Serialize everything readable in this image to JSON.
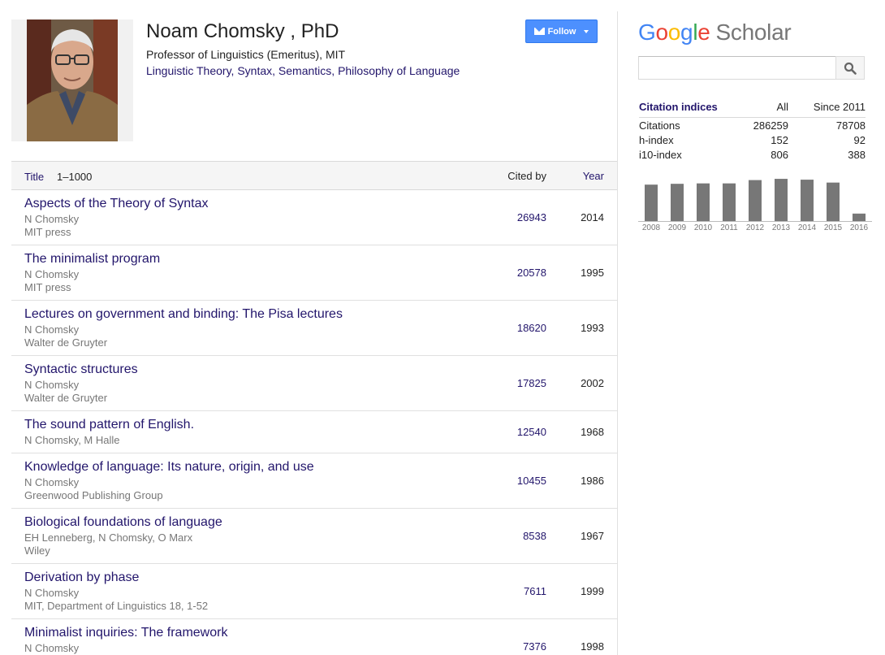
{
  "profile": {
    "name": "Noam Chomsky , PhD",
    "affiliation": "Professor of Linguistics (Emeritus), MIT",
    "interests": [
      "Linguistic Theory",
      "Syntax",
      "Semantics",
      "Philosophy of Language"
    ],
    "follow_label": "Follow"
  },
  "table": {
    "header": {
      "title": "Title",
      "range": "1–1000",
      "cited_by": "Cited by",
      "year": "Year"
    },
    "rows": [
      {
        "title": "Aspects of the Theory of Syntax",
        "authors": "N Chomsky",
        "venue": "MIT press",
        "cited": "26943",
        "year": "2014"
      },
      {
        "title": "The minimalist program",
        "authors": "N Chomsky",
        "venue": "MIT press",
        "cited": "20578",
        "year": "1995"
      },
      {
        "title": "Lectures on government and binding: The Pisa lectures",
        "authors": "N Chomsky",
        "venue": "Walter de Gruyter",
        "cited": "18620",
        "year": "1993"
      },
      {
        "title": "Syntactic structures",
        "authors": "N Chomsky",
        "venue": "Walter de Gruyter",
        "cited": "17825",
        "year": "2002"
      },
      {
        "title": "The sound pattern of English.",
        "authors": "N Chomsky, M Halle",
        "venue": "",
        "cited": "12540",
        "year": "1968"
      },
      {
        "title": "Knowledge of language: Its nature, origin, and use",
        "authors": "N Chomsky",
        "venue": "Greenwood Publishing Group",
        "cited": "10455",
        "year": "1986"
      },
      {
        "title": "Biological foundations of language",
        "authors": "EH Lenneberg, N Chomsky, O Marx",
        "venue": "Wiley",
        "cited": "8538",
        "year": "1967"
      },
      {
        "title": "Derivation by phase",
        "authors": "N Chomsky",
        "venue": "MIT, Department of Linguistics 18, 1-52",
        "cited": "7611",
        "year": "1999"
      },
      {
        "title": "Minimalist inquiries: The framework",
        "authors": "N Chomsky",
        "venue": "",
        "cited": "7376",
        "year": "1998"
      }
    ]
  },
  "sidebar": {
    "logo_google": "Google",
    "logo_scholar": "Scholar",
    "search_placeholder": "",
    "search_icon": "search-icon",
    "citation": {
      "label": "Citation indices",
      "col_all": "All",
      "col_since": "Since 2011",
      "rows": [
        {
          "key": "Citations",
          "all": "286259",
          "since": "78708"
        },
        {
          "key": "h-index",
          "all": "152",
          "since": "92"
        },
        {
          "key": "i10-index",
          "all": "806",
          "since": "388"
        }
      ]
    }
  },
  "chart_data": {
    "type": "bar",
    "categories": [
      "2008",
      "2009",
      "2010",
      "2011",
      "2012",
      "2013",
      "2014",
      "2015",
      "2016"
    ],
    "values": [
      8800,
      9000,
      9100,
      9100,
      9900,
      10200,
      10000,
      9300,
      1800
    ],
    "ylim": [
      0,
      11000
    ],
    "grid": false,
    "bar_color": "#777777"
  },
  "colors": {
    "link": "#22156b",
    "follow_button": "#4d90fe"
  }
}
